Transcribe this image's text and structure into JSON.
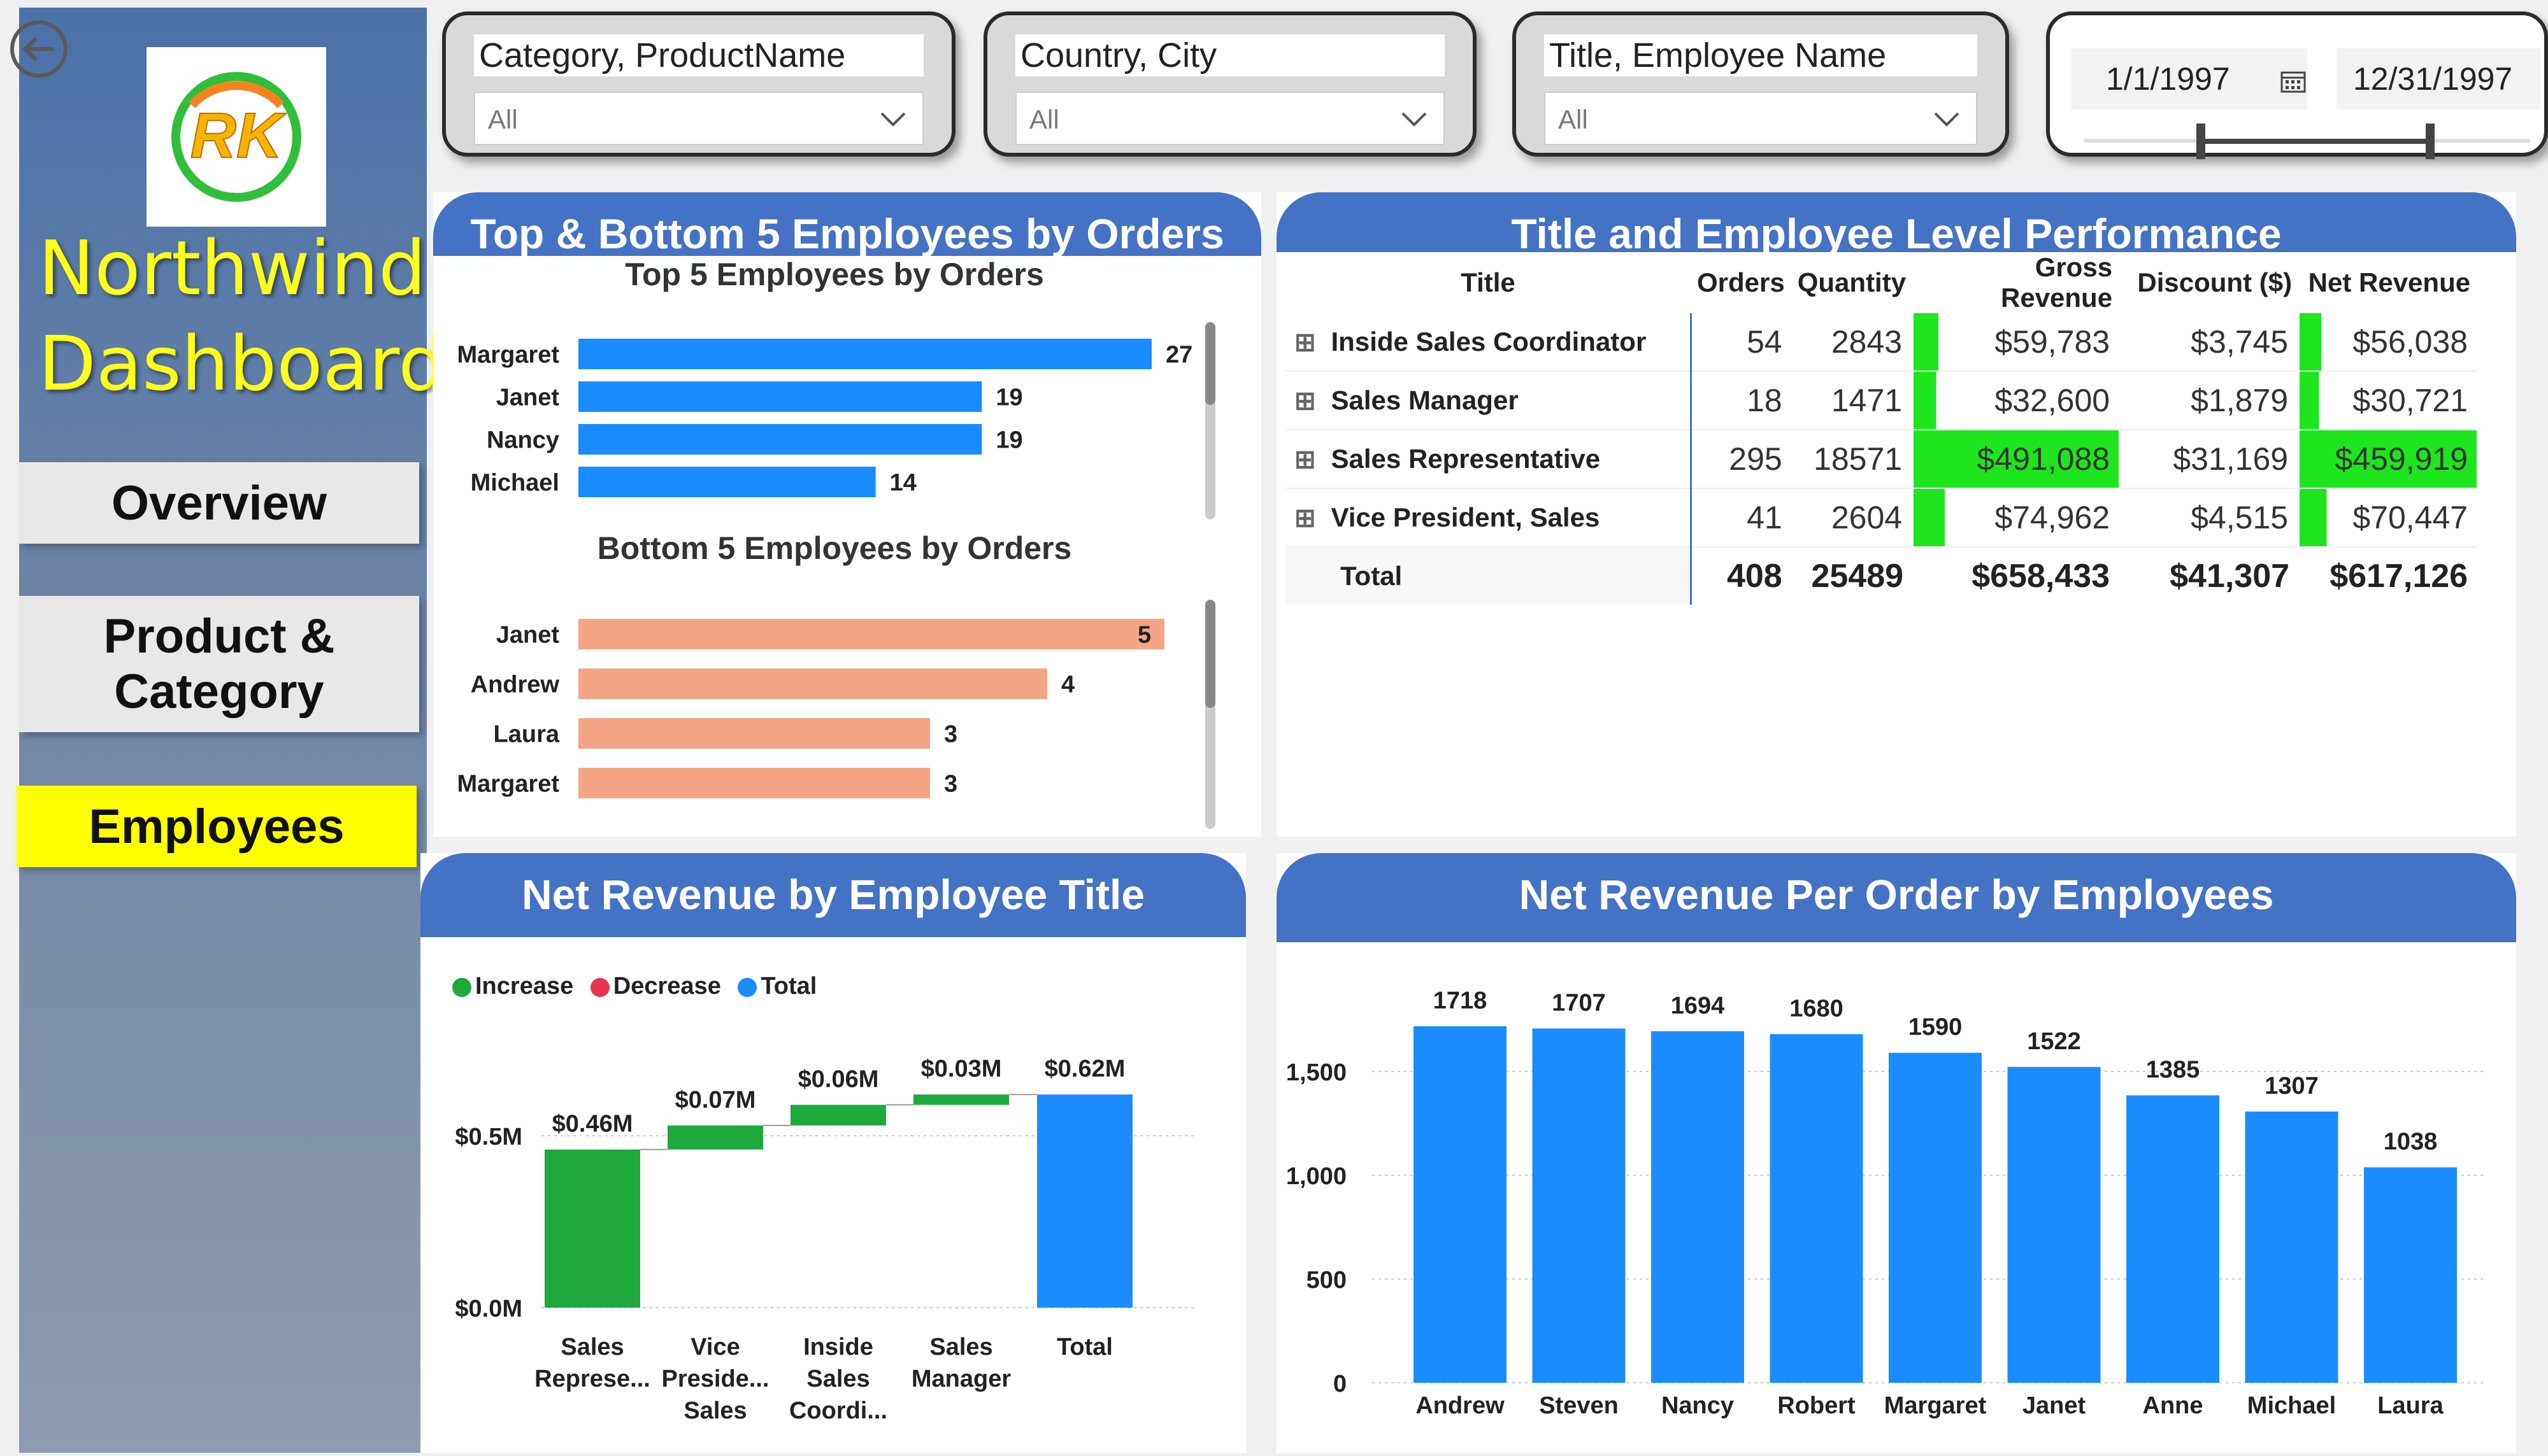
{
  "sidebar": {
    "brand_line1": "Northwind",
    "brand_line2": "Dashboard",
    "logo_text": "RK",
    "nav": [
      {
        "label": "Overview"
      },
      {
        "label_line1": "Product &",
        "label_line2": "Category"
      },
      {
        "label": "Employees"
      }
    ]
  },
  "slicers": {
    "category": {
      "title": "Category, ProductName",
      "value": "All"
    },
    "country": {
      "title": "Country, City",
      "value": "All"
    },
    "employee": {
      "title": "Title, Employee Name",
      "value": "All"
    },
    "date": {
      "start": "1/1/1997",
      "end": "12/31/1997"
    }
  },
  "top_bottom": {
    "title": "Top & Bottom 5 Employees by Orders",
    "top_title": "Top 5 Employees by Orders",
    "bottom_title": "Bottom 5 Employees by Orders"
  },
  "matrix": {
    "title": "Title and Employee  Level Performance",
    "headers": [
      "Title",
      "Orders",
      "Quantity",
      "Gross Revenue",
      "Discount ($)",
      "Net Revenue"
    ],
    "rows": [
      {
        "title": "Inside Sales Coordinator",
        "orders": "54",
        "quantity": "2843",
        "gross": "$59,783",
        "discount": "$3,745",
        "net": "$56,038"
      },
      {
        "title": "Sales Manager",
        "orders": "18",
        "quantity": "1471",
        "gross": "$32,600",
        "discount": "$1,879",
        "net": "$30,721"
      },
      {
        "title": "Sales Representative",
        "orders": "295",
        "quantity": "18571",
        "gross": "$491,088",
        "discount": "$31,169",
        "net": "$459,919"
      },
      {
        "title": "Vice President, Sales",
        "orders": "41",
        "quantity": "2604",
        "gross": "$74,962",
        "discount": "$4,515",
        "net": "$70,447"
      }
    ],
    "total": {
      "label": "Total",
      "orders": "408",
      "quantity": "25489",
      "gross": "$658,433",
      "discount": "$41,307",
      "net": "$617,126"
    },
    "highlight_color": "#1ee61e"
  },
  "waterfall_title": "Net Revenue by Employee Title",
  "per_order_title": "Net Revenue Per Order by Employees",
  "colors": {
    "accent": "#4472c4",
    "blue_bar": "#1a8cff",
    "salmon_bar": "#f4a585",
    "increase": "#1fa83c",
    "decrease": "#e8344e",
    "total": "#1a8cff",
    "highlight_nav": "#ffff00"
  },
  "chart_data": [
    {
      "type": "bar",
      "title": "Top 5 Employees by Orders",
      "orientation": "horizontal",
      "categories": [
        "Margaret",
        "Janet",
        "Nancy",
        "Michael"
      ],
      "values": [
        27,
        19,
        19,
        14
      ],
      "value_labels": [
        "27",
        "19",
        "19",
        "14"
      ]
    },
    {
      "type": "bar",
      "title": "Bottom 5 Employees by Orders",
      "orientation": "horizontal",
      "categories": [
        "Janet",
        "Andrew",
        "Laura",
        "Margaret"
      ],
      "values": [
        5,
        4,
        3,
        3
      ],
      "value_labels": [
        "5",
        "4",
        "3",
        "3"
      ]
    },
    {
      "type": "bar",
      "subtype": "waterfall",
      "title": "Net Revenue by Employee Title",
      "legend": [
        "Increase",
        "Decrease",
        "Total"
      ],
      "legend_position": "top-left",
      "categories": [
        [
          "Sales",
          "Represe..."
        ],
        [
          "Vice",
          "Preside...",
          "Sales"
        ],
        [
          "Inside",
          "Sales",
          "Coordi..."
        ],
        [
          "Sales",
          "Manager"
        ],
        [
          "Total"
        ]
      ],
      "values": [
        0.46,
        0.07,
        0.06,
        0.03,
        0.62
      ],
      "kinds": [
        "increase",
        "increase",
        "increase",
        "increase",
        "total"
      ],
      "value_labels": [
        "$0.46M",
        "$0.07M",
        "$0.06M",
        "$0.03M",
        "$0.62M"
      ],
      "yticks": [
        "$0.0M",
        "$0.5M"
      ],
      "ylim": [
        0,
        0.62
      ]
    },
    {
      "type": "bar",
      "title": "Net Revenue Per Order by Employees",
      "categories": [
        "Andrew",
        "Steven",
        "Nancy",
        "Robert",
        "Margaret",
        "Janet",
        "Anne",
        "Michael",
        "Laura"
      ],
      "values": [
        1718,
        1707,
        1694,
        1680,
        1590,
        1522,
        1385,
        1307,
        1038
      ],
      "value_labels": [
        "1718",
        "1707",
        "1694",
        "1680",
        "1590",
        "1522",
        "1385",
        "1307",
        "1038"
      ],
      "yticks": [
        "0",
        "500",
        "1,000",
        "1,500"
      ],
      "ylim": [
        0,
        1800
      ]
    }
  ]
}
